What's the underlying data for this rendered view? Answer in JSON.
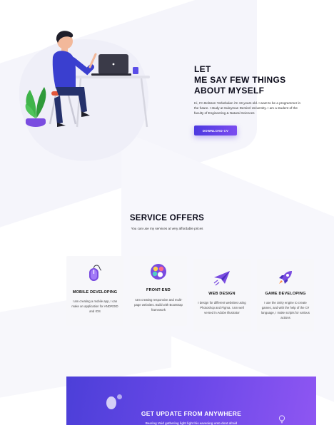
{
  "hero": {
    "title": "LET\nME SAY FEW THINGS\nABOUT MYSELF",
    "body": "Hi, I'm Bolsson Yerkebulan i'm 19 years old. I want to be a programmer in the future. I study at Suleyman Demirel University. I am a student of the faculty of Engineering & Natural Sciences",
    "cv_button": "DOWNLOAD CV"
  },
  "services": {
    "title": "SERVICE OFFERS",
    "subtitle": "You can use my services at very affordable prices",
    "cards": [
      {
        "icon": "mouse-icon",
        "title": "MOBILE DEVELOPING",
        "desc": "I am creating a mobile app, I can make an application for ANDROID and IOS"
      },
      {
        "icon": "palette-icon",
        "title": "FRONT-END",
        "desc": "I am creating responsive and multi-page websites. Build with Bootstrap framework"
      },
      {
        "icon": "paper-plane-icon",
        "title": "WEB DESIGN",
        "desc": "I design for different websites using Photoshop and Figma. I am well versed in Adobe Illustrator"
      },
      {
        "icon": "rocket-icon",
        "title": "GAME DEVELOPING",
        "desc": "I use the Unity engine to create games, and with the help of the C# language, I make scripts for various actions"
      }
    ]
  },
  "cta": {
    "title": "GET UPDATE FROM ANYWHERE",
    "subtitle": "Bearing Void gathering light light his eavening unto dont afraid"
  },
  "colors": {
    "accent": "#5b3fe4",
    "accent_light": "#8e56f2",
    "card_bg": "#f7f7fa",
    "plant": "#3fb44a",
    "pot": "#7a4ce0",
    "shirt": "#3a3fcf"
  }
}
